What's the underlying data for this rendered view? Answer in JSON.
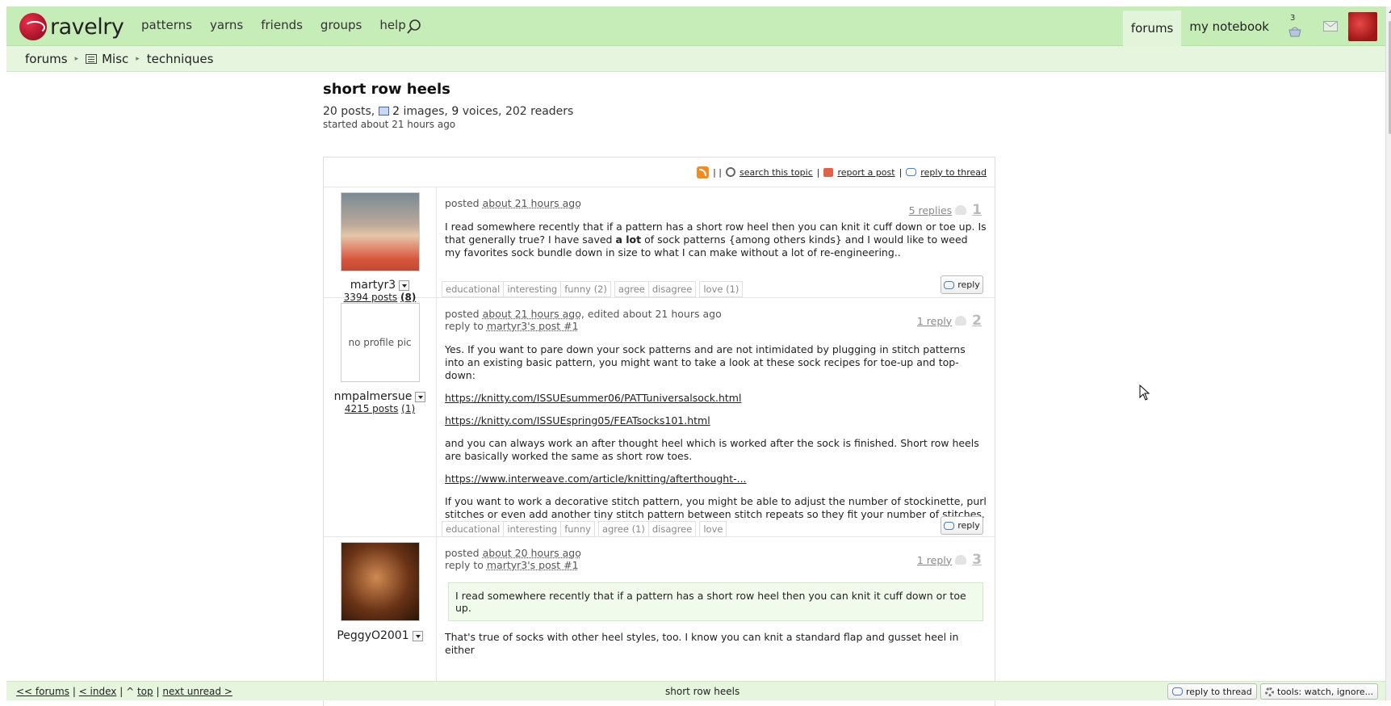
{
  "header": {
    "logo_text": "ravelry",
    "nav": [
      "patterns",
      "yarns",
      "friends",
      "groups",
      "help"
    ],
    "right": {
      "forums": "forums",
      "notebook": "my notebook",
      "basket_count": "3"
    }
  },
  "breadcrumb": {
    "forums": "forums",
    "misc": "Misc",
    "techniques": "techniques"
  },
  "topic": {
    "title": "short row heels",
    "posts_count": "20 posts,",
    "images_count": "2",
    "images_label": " images,",
    "voices_count": "9",
    "voices_label": " voices, 202 readers",
    "started": "started about 21 hours ago"
  },
  "toolbar": {
    "sep": "| |",
    "search": "search this topic",
    "report": "report a post",
    "reply_thread": "reply to thread"
  },
  "posts": [
    {
      "username": "martyr3",
      "post_count": "3394 posts",
      "badge": "(8)",
      "posted_prefix": "posted",
      "posted_time": "about 21 hours ago",
      "replies": "5 replies",
      "number": "1",
      "body_a": "I read somewhere recently that if a pattern has a short row heel then you can knit it cuff down or toe up. Is that generally true? I have saved ",
      "body_bold": "a lot",
      "body_b": " of sock patterns {among others kinds} and I would like to weed my favorites sock bundle down in size to what I can make without a lot of re-engineering..",
      "tags1": [
        "educational",
        "interesting",
        "funny (2)"
      ],
      "tags2": [
        "agree",
        "disagree"
      ],
      "tags3": [
        "love (1)"
      ],
      "reply_label": "reply"
    },
    {
      "username": "nmpalmersue",
      "no_pic": "no profile pic",
      "post_count": "4215 posts",
      "badge": "(1)",
      "posted_prefix": "posted",
      "posted_time": "about 21 hours ago",
      "edited": ", edited about 21 hours ago",
      "reply_to_prefix": "reply to ",
      "reply_to": "martyr3's post #1",
      "replies": "1 reply",
      "number": "2",
      "p1": "Yes. If you want to pare down your sock patterns and are not intimidated by plugging in stitch patterns into an existing basic pattern, you might want to take a look at these sock recipes for toe-up and top-down:",
      "link1": "https://knitty.com/ISSUEsummer06/PATTuniversalsock.html",
      "link2": "https://knitty.com/ISSUEspring05/FEATsocks101.html",
      "p2": "and you can always work an after thought heel which is worked after the sock is finished. Short row heels are basically worked the same as short row toes.",
      "link3": "https://www.interweave.com/article/knitting/afterthought-...",
      "p3": "If you want to work a decorative stitch pattern, you might be able to adjust the number of stockinette, purl stitches or even add another tiny stitch pattern between stitch repeats so they fit your number of stitches.",
      "tags1": [
        "educational",
        "interesting",
        "funny"
      ],
      "tags2": [
        "agree (1)",
        "disagree"
      ],
      "tags3": [
        "love"
      ],
      "reply_label": "reply"
    },
    {
      "username": "PeggyO2001",
      "posted_prefix": "posted",
      "posted_time": "about 20 hours ago",
      "reply_to_prefix": "reply to ",
      "reply_to": "martyr3's post #1",
      "replies": "1 reply",
      "number": "3",
      "quote": "I read somewhere recently that if a pattern has a short row heel then you can knit it cuff down or toe up.",
      "p1": "That's true of socks with other heel styles, too. I know you can knit a standard flap and gusset heel in either"
    }
  ],
  "bottombar": {
    "forums": "<< forums",
    "index": "< index",
    "top": "top",
    "next": "next unread >",
    "center": "short row heels",
    "reply_thread": "reply to thread",
    "tools": "tools: watch, ignore..."
  }
}
